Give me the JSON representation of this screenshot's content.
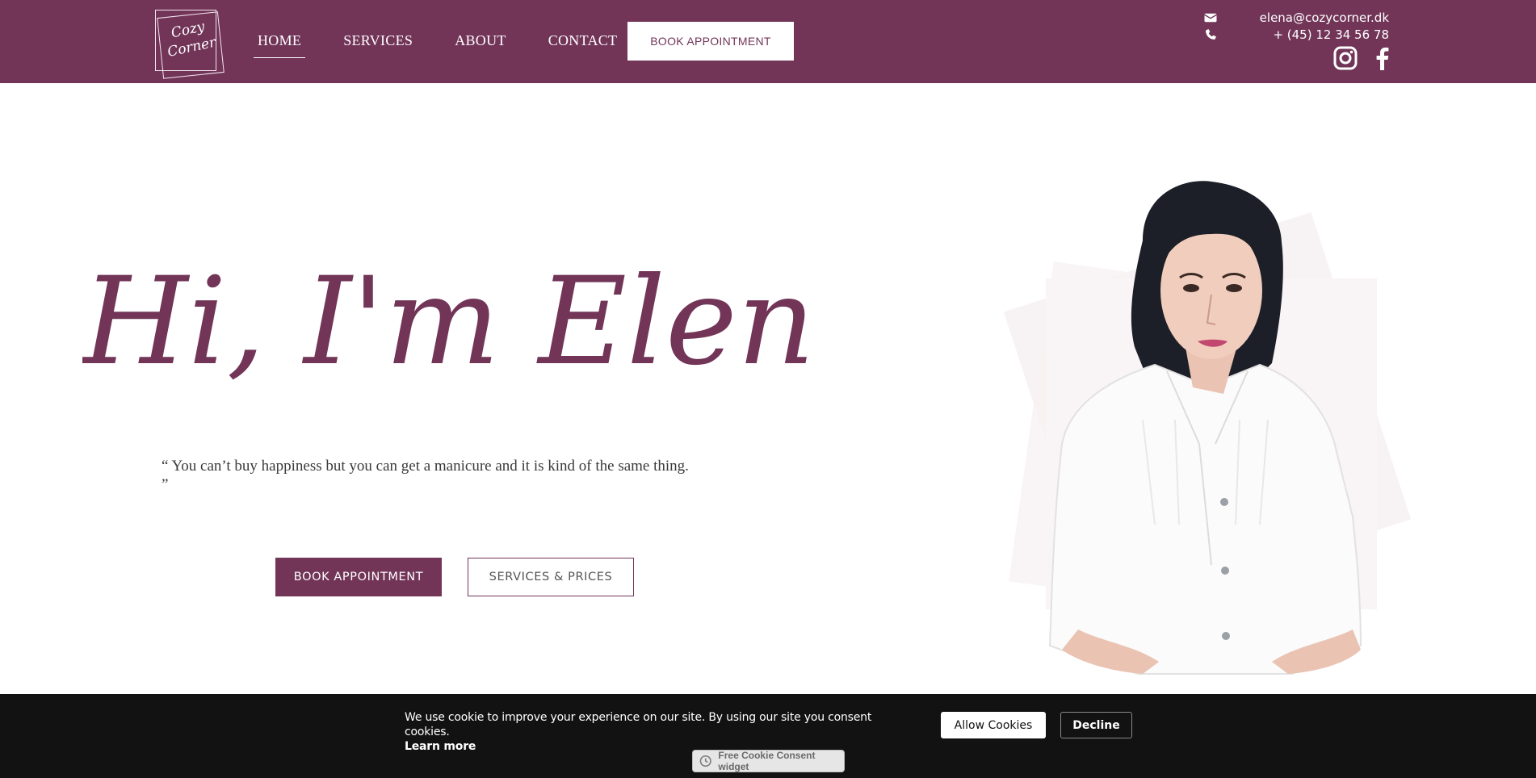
{
  "header": {
    "logo_text": [
      "Cozy",
      "Corner"
    ],
    "nav": [
      {
        "label": "HOME",
        "active": true
      },
      {
        "label": "SERVICES",
        "active": false
      },
      {
        "label": "ABOUT",
        "active": false
      },
      {
        "label": "CONTACT",
        "active": false
      }
    ],
    "book_label": "BOOK APPOINTMENT",
    "email": "elena@cozycorner.dk",
    "phone": "+ (45) 12 34 56 78",
    "icons": [
      "envelope-icon",
      "phone-icon",
      "instagram-icon",
      "facebook-icon"
    ]
  },
  "hero": {
    "title": "Hi, I'm Elena",
    "quote": "“ You can’t buy happiness but you can get a manicure and it is kind of the same thing. ”",
    "primary_button": "BOOK APPOINTMENT",
    "secondary_button": "SERVICES & PRICES"
  },
  "cookie": {
    "message": "We use cookie to improve your experience on our site. By using our site you consent cookies.",
    "learn_more": "Learn more",
    "allow": "Allow Cookies",
    "decline": "Decline",
    "widget": "Free Cookie Consent widget"
  },
  "colors": {
    "brand": "#723558",
    "white": "#ffffff",
    "cookie_bg": "#121212"
  }
}
